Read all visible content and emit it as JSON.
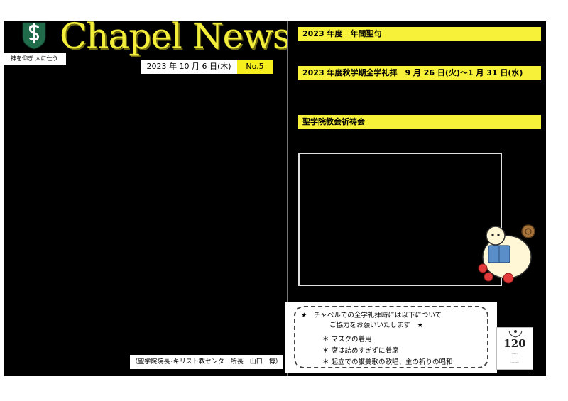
{
  "masthead": {
    "title": "Chapel News",
    "motto": "神を仰ぎ 人に仕う",
    "date": "2023 年 10 月 6 日(木)",
    "issue": "No.5"
  },
  "left": {
    "author": "（聖学院院長･キリスト教センター所長　山口　博）"
  },
  "right": {
    "heading_annual": "2023 年度　年間聖句",
    "heading_worship": "2023 年度秋学期全学礼拝　9 月 26 日(火)～1 月 31 日(水)",
    "heading_prayer": "聖学院教会祈祷会"
  },
  "notice": {
    "line1": "★　チャペルでの全学礼拝時には以下について",
    "line2": "ご協力をお願いいたします　★",
    "items": [
      "＊ マスクの着用",
      "＊ 席は詰めすぎずに着席",
      "＊ 起立での讃美歌の歌唱、主の祈りの唱和"
    ]
  },
  "badge": {
    "number": "120"
  },
  "colors": {
    "accent_yellow": "#f7f13a",
    "background": "#000000",
    "logo_green": "#1f6b4a"
  }
}
